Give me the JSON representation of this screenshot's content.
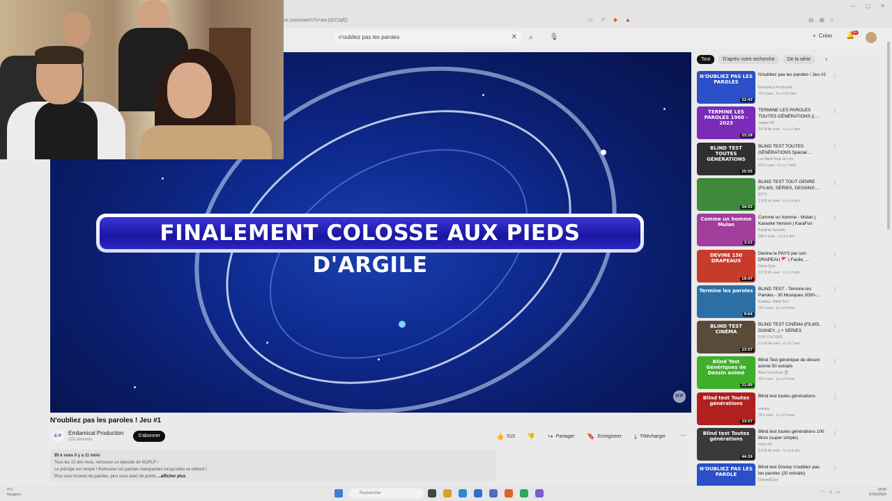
{
  "browser": {
    "url": "bs.com/watch?v=aw1jDZJqfQ",
    "window_controls": [
      "—",
      "▢",
      "✕"
    ]
  },
  "header": {
    "search_value": "n'oubliez pas les paroles",
    "create_label": "Créer",
    "notification_count": "9+"
  },
  "video": {
    "banner_text": "FINALEMENT COLOSSE AUX PIEDS D'ARGILE",
    "logo_text": "N'P",
    "title": "N'oubliez pas les paroles ! Jeu #1"
  },
  "channel": {
    "avatar_text": "E·P",
    "name": "Emilamical Production",
    "subscribers": "101 abonnés",
    "subscribe_label": "S'abonner"
  },
  "actions": {
    "likes": "515",
    "share": "Partager",
    "save": "Enregistrer",
    "download": "Télécharger"
  },
  "description": {
    "stats": "85 k vues  il y a 11 mois",
    "line1": "Tous les 15 des mois, retrouvez un épisode de NOPLP !",
    "line2": "Le principe est simple ! Retrouvez les paroles manquantes lorsqu'elles se retirent !",
    "line3": "Plus vous trouvez de paroles, plus vous avez de points",
    "more": "...afficher plus"
  },
  "chips": [
    "Tout",
    "D'après votre recherche",
    "De la série"
  ],
  "recommendations": [
    {
      "title": "N'oubliez pas les paroles ! Jeu #2",
      "channel": "Emilamical Production",
      "meta": "79 k vues · il y a 10 mois",
      "duration": "22:43",
      "thumb_text": "N'OUBLIEZ PAS LES PAROLES",
      "color": "#2a4fc6"
    },
    {
      "title": "TERMINE LES PAROLES TOUTES GÉNÉRATIONS || ...",
      "channel": "Jasper FR",
      "meta": "3,8 M de vues · il y a 2 ans",
      "duration": "23:28",
      "thumb_text": "TERMINE LES PAROLES 1960 - 2023",
      "color": "#7a2bb8"
    },
    {
      "title": "BLIND TEST TOUTES GÉNÉRATIONS Spécial ...",
      "channel": "Les Blind Tests de Léo",
      "meta": "112 k vues · il y a 1 mois",
      "duration": "25:55",
      "thumb_text": "BLIND TEST TOUTES GÉNÉRATIONS",
      "color": "#303030"
    },
    {
      "title": "BLIND TEST TOUT GENRE (FILMS, SÉRIES, DESSINS ...",
      "channel": "BTTV",
      "meta": "1,9 M de vues · il y a 4 ans",
      "duration": "34:55",
      "thumb_text": "",
      "color": "#3d8a3a"
    },
    {
      "title": "Comme un homme - Mulan | Karaoke Version | KaraFun",
      "channel": "KaraFun Karaoke",
      "meta": "306 k vues · il y a 4 ans",
      "duration": "3:22",
      "thumb_text": "Comme un homme Mulan",
      "color": "#a23d9c"
    },
    {
      "title": "Devine le PAYS par son DRAPEAU 🚩 | Facile, ...",
      "channel": "Devin Quiz",
      "meta": "2,5 M de vues · il y a 2 ans",
      "duration": "19:47",
      "thumb_text": "DEVINE 150 DRAPEAUX",
      "color": "#c63b2a"
    },
    {
      "title": "BLIND TEST - Termine les Paroles - 30 Musiques 2000-...",
      "channel": "Kadima - Blind Test",
      "meta": "79 k vues · il y a 4 mois",
      "duration": "9:04",
      "thumb_text": "Termine les paroles",
      "color": "#2b6fa6"
    },
    {
      "title": "BLIND TEST CINÉMA (FILMS, DISNEY...) + SÉRIES",
      "channel": "POP CULTURE",
      "meta": "2,5 M de vues · il y a 7 ans",
      "duration": "23:57",
      "thumb_text": "BLIND TEST CINÉMA",
      "color": "#5a4a3a"
    },
    {
      "title": "Blind Test générique de dessin animé 50 extraits",
      "channel": "Blind Test Music 🎵",
      "meta": "19 k vues · il y a 5 mois",
      "duration": "21:00",
      "thumb_text": "Blind Test Génériques de Dessin animé",
      "color": "#3fae2a"
    },
    {
      "title": "Blind test toutes générations",
      "channel": "antoine",
      "meta": "78 k vues · il y a 3 mois",
      "duration": "23:57",
      "thumb_text": "Blind test Toutes générations",
      "color": "#b0201e"
    },
    {
      "title": "Blind test toutes générations 100 titres (super simple)",
      "channel": "antho-62",
      "meta": "1,8 M de vues · il y a 3 ans",
      "duration": "44:39",
      "thumb_text": "Blind test Toutes générations",
      "color": "#3a3a3a"
    },
    {
      "title": "Blind test Disney n'oubliez pas les paroles (20 extraits)",
      "channel": "DisneyBQuiz",
      "meta": "",
      "duration": "",
      "thumb_text": "N'OUBLIEZ PAS LES PAROLE",
      "color": "#2a4fc6"
    }
  ],
  "taskbar": {
    "weather_temp": "4°C",
    "weather_desc": "Nuageux",
    "search_placeholder": "Rechercher",
    "time": "18:56",
    "date": "07/02/2024"
  }
}
